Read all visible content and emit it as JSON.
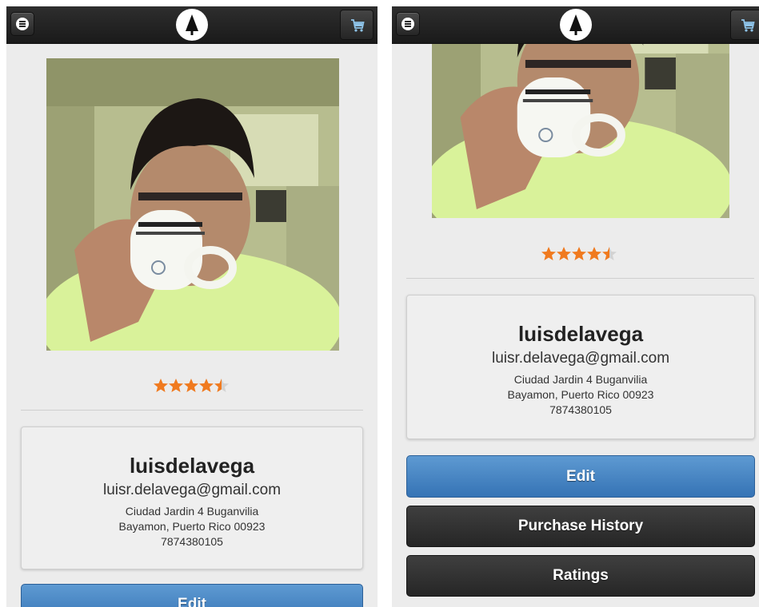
{
  "profile": {
    "username": "luisdelavega",
    "email": "luisr.delavega@gmail.com",
    "address_line1": "Ciudad Jardin 4 Buganvilia",
    "address_line2": "Bayamon, Puerto Rico 00923",
    "phone": "7874380105",
    "rating": 4.5,
    "rating_max": 5
  },
  "actions": {
    "edit_label": "Edit",
    "purchase_history_label": "Purchase History",
    "ratings_label": "Ratings"
  },
  "icons": {
    "menu": "menu-icon",
    "logo": "tree-logo-icon",
    "cart": "cart-icon",
    "star": "star-icon"
  },
  "colors": {
    "topbar": "#1f1f1f",
    "edit_button": "#3f7fc0",
    "dark_button": "#2f2f2f",
    "star": "#f07a1f",
    "page_background": "#ececec"
  }
}
